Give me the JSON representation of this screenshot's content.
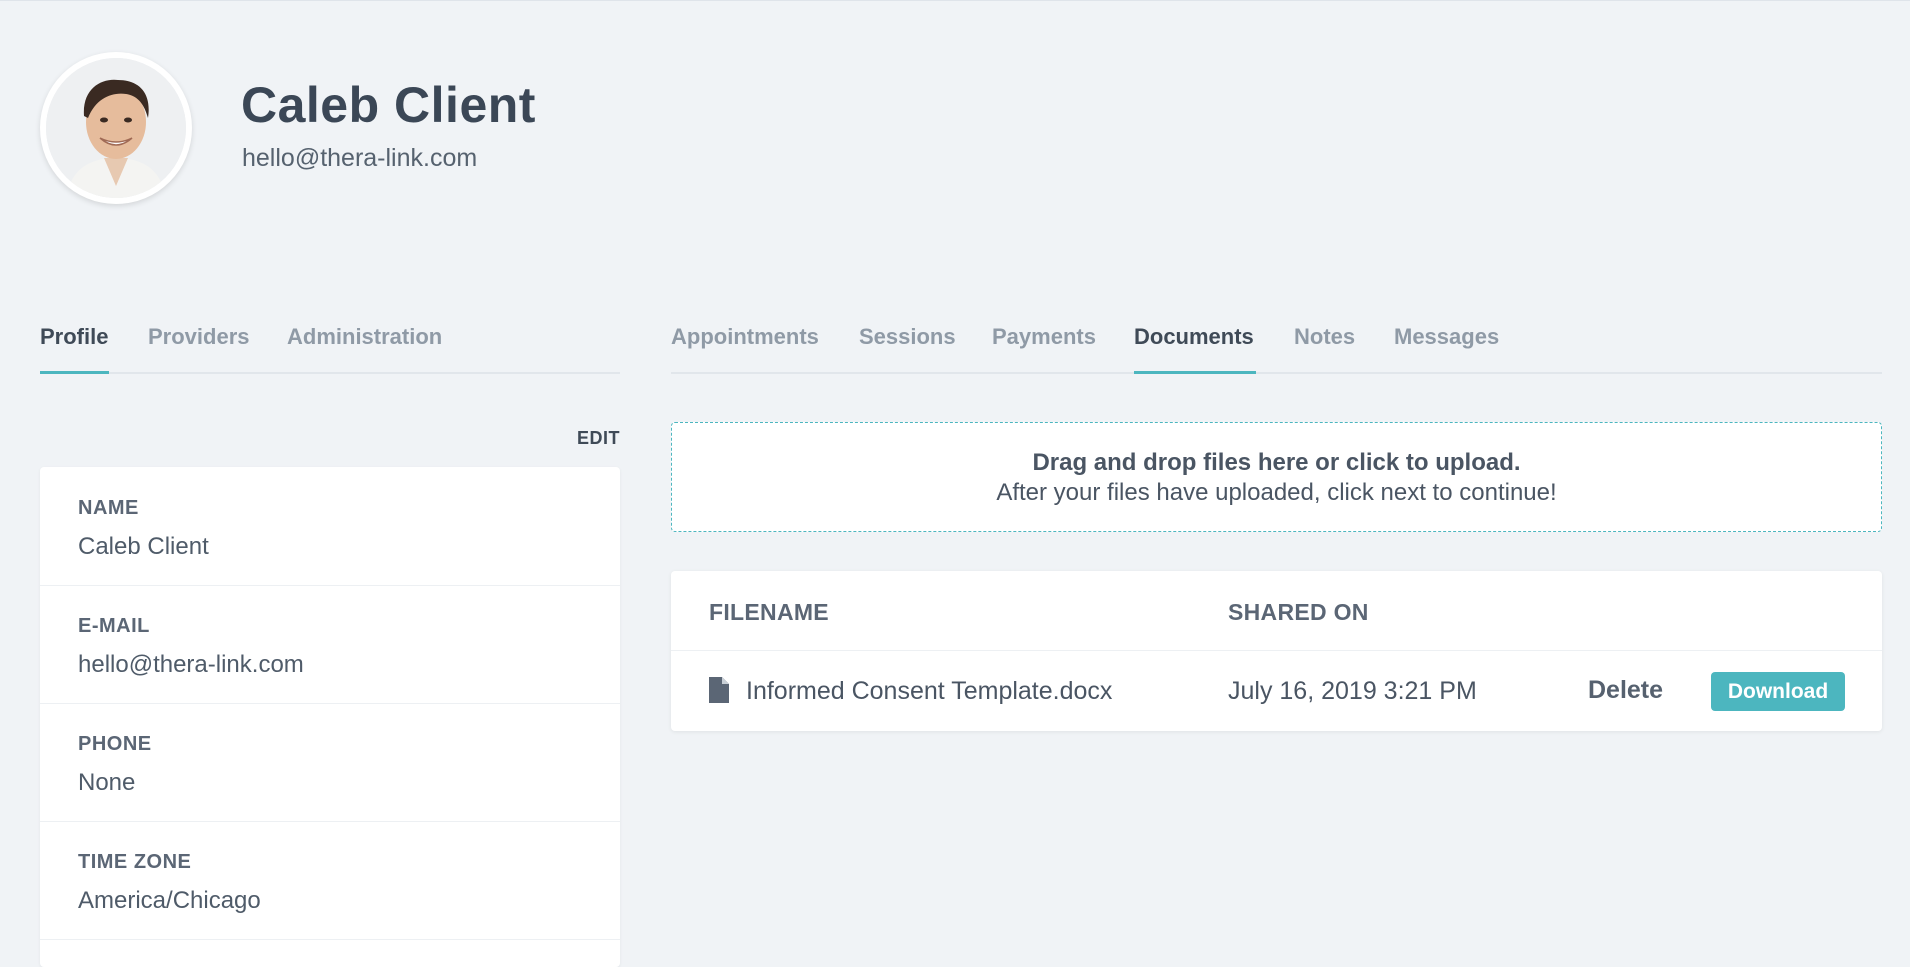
{
  "header": {
    "name": "Caleb Client",
    "email": "hello@thera-link.com"
  },
  "left_tabs": [
    {
      "label": "Profile",
      "active": true
    },
    {
      "label": "Providers",
      "active": false
    },
    {
      "label": "Administration",
      "active": false
    }
  ],
  "right_tabs": [
    {
      "label": "Appointments",
      "active": false
    },
    {
      "label": "Sessions",
      "active": false
    },
    {
      "label": "Payments",
      "active": false
    },
    {
      "label": "Documents",
      "active": true
    },
    {
      "label": "Notes",
      "active": false
    },
    {
      "label": "Messages",
      "active": false
    }
  ],
  "profile": {
    "edit_label": "EDIT",
    "fields": [
      {
        "label": "NAME",
        "value": "Caleb Client"
      },
      {
        "label": "E-MAIL",
        "value": "hello@thera-link.com"
      },
      {
        "label": "PHONE",
        "value": "None"
      },
      {
        "label": "TIME ZONE",
        "value": "America/Chicago"
      }
    ]
  },
  "upload": {
    "title": "Drag and drop files here or click to upload.",
    "subtitle": "After your files have uploaded, click next to continue!"
  },
  "documents": {
    "columns": [
      "FILENAME",
      "SHARED ON"
    ],
    "rows": [
      {
        "filename": "Informed Consent Template.docx",
        "shared_on": "July 16, 2019 3:21 PM",
        "delete_label": "Delete",
        "download_label": "Download",
        "icon": "file-icon"
      }
    ]
  },
  "colors": {
    "accent": "#4cb6bf",
    "background": "#f0f3f6",
    "heading_text": "#3b4756",
    "muted_tab": "#8f9aa6"
  }
}
